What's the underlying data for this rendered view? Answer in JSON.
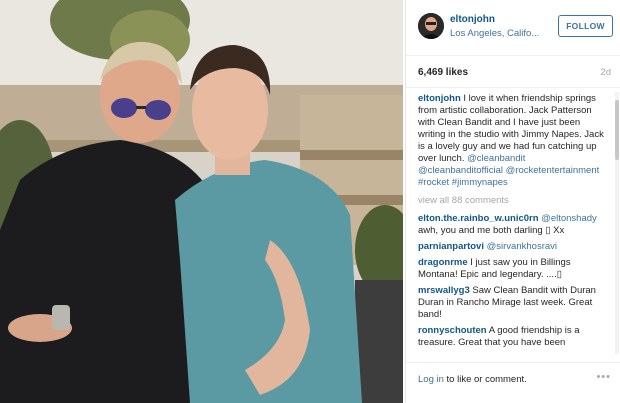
{
  "header": {
    "username": "eltonjohn",
    "location": "Los Angeles, Califo...",
    "follow_label": "FOLLOW"
  },
  "stats": {
    "likes": "6,469 likes",
    "time": "2d"
  },
  "caption": {
    "user": "eltonjohn",
    "text": " I love it when friendship springs from artistic collaboration. Jack Patterson with Clean Bandit and I have just been writing in the studio with Jimmy Napes. Jack is a lovely guy and we had fun catching up over lunch. ",
    "tags": [
      "@cleanbandit",
      "@cleanbanditofficial",
      "@rocketentertainment",
      "#rocket",
      "#jimmynapes"
    ]
  },
  "view_all": "view all 88 comments",
  "comments": [
    {
      "user": "elton.the.rainbo_w.unic0rn",
      "tag": " @eltonshady",
      "text": " awh, you and me both darling ▯ Xx"
    },
    {
      "user": "parnianpartovi",
      "tag": " @sirvankhosravi",
      "text": ""
    },
    {
      "user": "dragonrme",
      "tag": "",
      "text": " I just saw you in Billings Montana! Epic and legendary. ....▯"
    },
    {
      "user": "mrswallyg3",
      "tag": "",
      "text": " Saw Clean Bandit with Duran Duran in Rancho Mirage last week. Great band!"
    },
    {
      "user": "ronnyschouten",
      "tag": "",
      "text": " A good friendship is a treasure. Great that you have been"
    }
  ],
  "footer": {
    "login_link": "Log in",
    "login_text": " to like or comment.",
    "more": "•••"
  },
  "colors": {
    "username_blue": "#125688",
    "link_blue": "#3f729b",
    "muted_gray": "#a5a7aa",
    "text": "#262626"
  },
  "icons": [
    "avatar",
    "more-options-icon"
  ]
}
